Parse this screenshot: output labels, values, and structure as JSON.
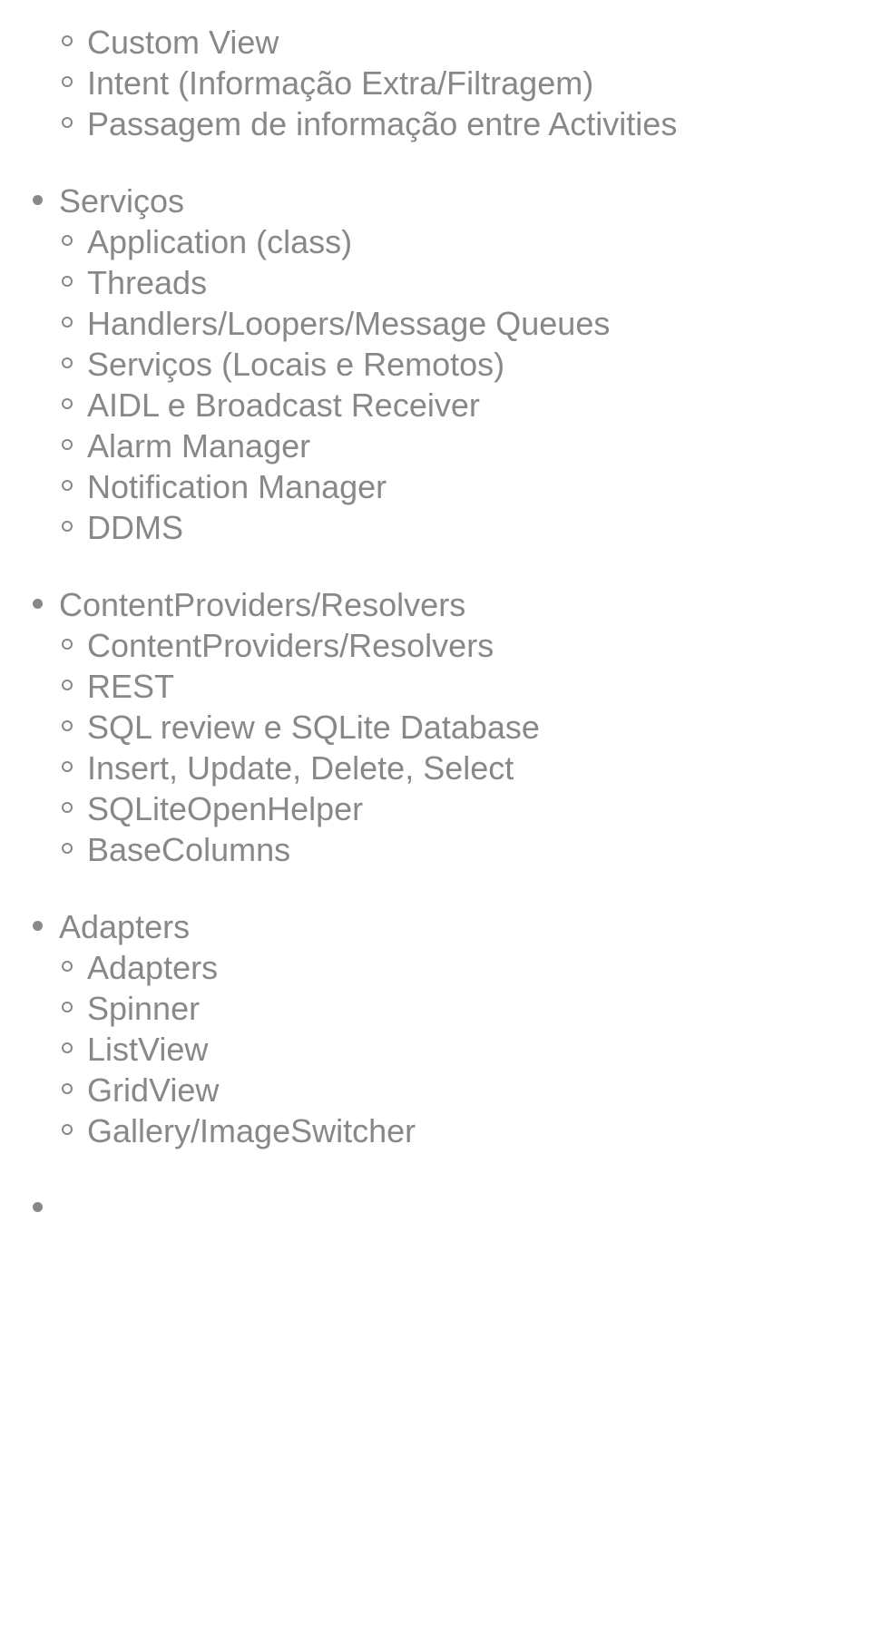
{
  "sections": [
    {
      "title": null,
      "orphan_subitems": [
        "Custom View",
        "Intent (Informação Extra/Filtragem)",
        "Passagem de informação entre Activities"
      ]
    },
    {
      "title": "Serviços",
      "subitems": [
        "Application (class)",
        "Threads",
        "Handlers/Loopers/Message Queues",
        "Serviços (Locais e Remotos)",
        "AIDL e Broadcast Receiver",
        "Alarm Manager",
        "Notification Manager",
        "DDMS"
      ]
    },
    {
      "title": "ContentProviders/Resolvers",
      "subitems": [
        "ContentProviders/Resolvers",
        "REST",
        "SQL review e SQLite Database",
        "Insert, Update, Delete, Select",
        "SQLiteOpenHelper",
        "BaseColumns"
      ]
    },
    {
      "title": "Adapters",
      "subitems": [
        "Adapters",
        "Spinner",
        "ListView",
        "GridView",
        "Gallery/ImageSwitcher"
      ]
    },
    {
      "title": "",
      "subitems": []
    }
  ]
}
